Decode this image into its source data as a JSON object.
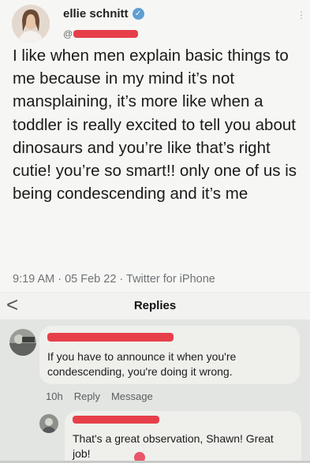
{
  "tweet": {
    "author_name": "ellie schnitt",
    "handle_prefix": "@",
    "text": "I like when men explain basic things to me because in my mind it’s not mansplaining, it’s more like when a toddler is really excited to tell you about dinosaurs and you’re like that’s right cutie! you’re so smart!! only one of us is being condescending and it’s me",
    "meta": "9:19 AM · 05 Feb 22 · Twitter for iPhone"
  },
  "replies_header": {
    "back_glyph": "<",
    "title": "Replies"
  },
  "comments": [
    {
      "text": "If you have to announce it when you're condescending, you're doing it wrong.",
      "time": "10h",
      "reply_label": "Reply",
      "message_label": "Message"
    },
    {
      "text": "That's a great observation, Shawn! Great job!"
    }
  ],
  "colors": {
    "redaction": "#e63f4a",
    "verified": "#5f9fd2"
  },
  "icons": [
    "verified-badge-icon",
    "back-chevron-icon",
    "reaction-icon"
  ]
}
